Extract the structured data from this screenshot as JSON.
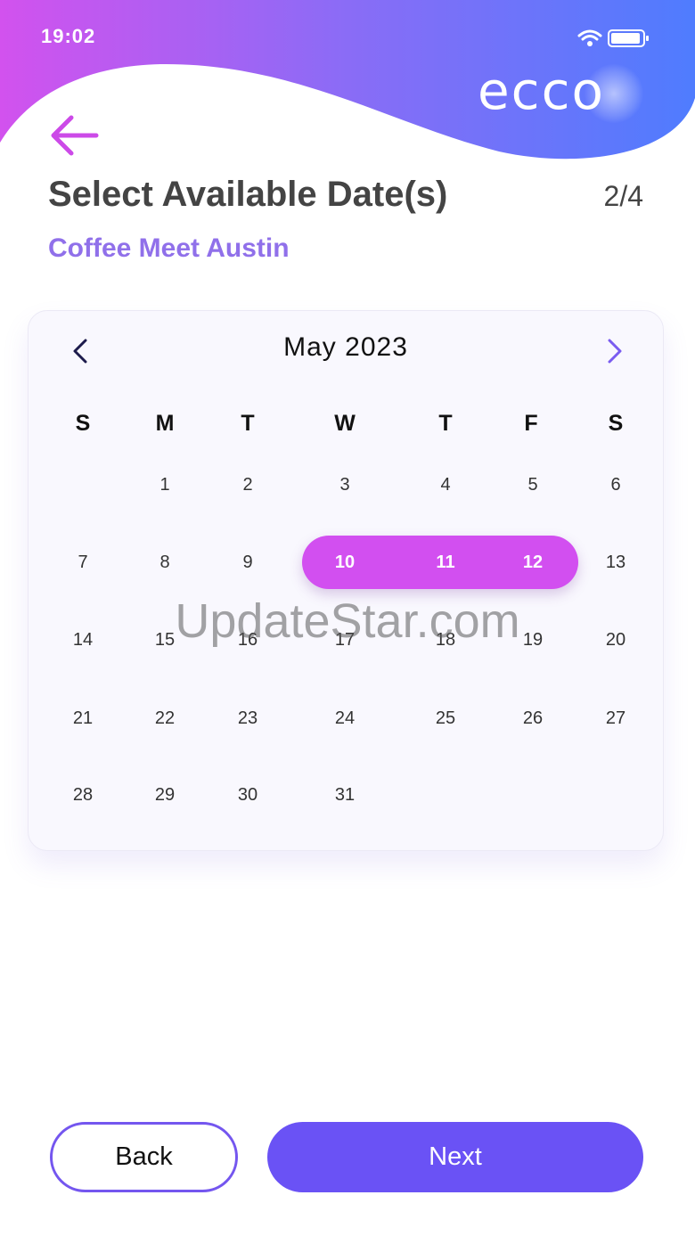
{
  "status_bar": {
    "time": "19:02",
    "icons": [
      "wifi-icon",
      "battery-icon"
    ]
  },
  "brand": {
    "logo_text": "ecco"
  },
  "header": {
    "title": "Select Available Date(s)",
    "step": "2/4",
    "event_name": "Coffee Meet Austin"
  },
  "calendar": {
    "month_label": "May 2023",
    "weekdays": [
      "S",
      "M",
      "T",
      "W",
      "T",
      "F",
      "S"
    ],
    "weeks": [
      [
        "",
        "1",
        "2",
        "3",
        "4",
        "5",
        "6"
      ],
      [
        "7",
        "8",
        "9",
        "10",
        "11",
        "12",
        "13"
      ],
      [
        "14",
        "15",
        "16",
        "17",
        "18",
        "19",
        "20"
      ],
      [
        "21",
        "22",
        "23",
        "24",
        "25",
        "26",
        "27"
      ],
      [
        "28",
        "29",
        "30",
        "31",
        "",
        "",
        ""
      ]
    ],
    "selected_dates": [
      "10",
      "11",
      "12"
    ],
    "selected_color": "#d24ff0"
  },
  "watermark": "UpdateStar.com",
  "actions": {
    "back_label": "Back",
    "next_label": "Next"
  },
  "colors": {
    "accent": "#6a52f5",
    "title_purple": "#9070ea",
    "back_arrow": "#cc4ae8"
  }
}
